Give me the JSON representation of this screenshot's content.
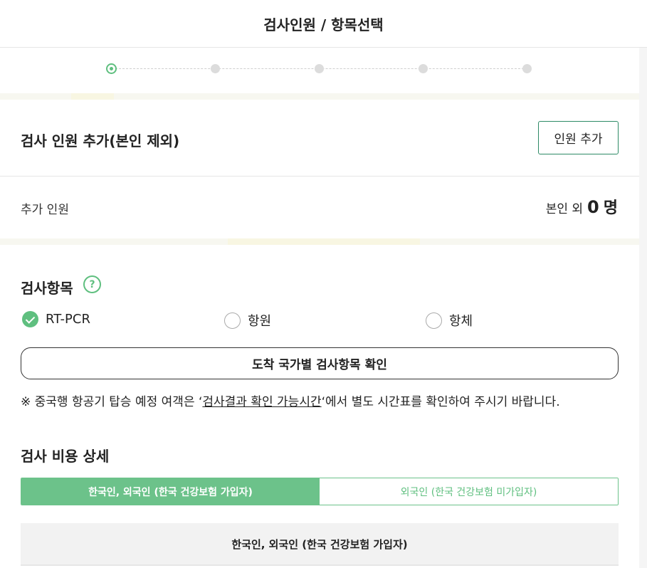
{
  "header": {
    "title": "검사인원 / 항목선택"
  },
  "steps": {
    "count": 5,
    "current": 1
  },
  "add_people": {
    "title": "검사 인원 추가(본인 제외)",
    "add_button": "인원 추가",
    "added_label": "추가 인원",
    "count_prefix": "본인 외",
    "count_value": "0",
    "count_unit": "명"
  },
  "test_items": {
    "title": "검사항목",
    "help_icon": "question-circle-icon",
    "options": [
      {
        "label": "RT-PCR",
        "checked": true
      },
      {
        "label": "항원",
        "checked": false
      },
      {
        "label": "항체",
        "checked": false
      }
    ],
    "country_button": "도착 국가별 검사항목 확인",
    "notice_prefix": "※ 중국행 항공기 탑승 예정 여객은 ‘",
    "notice_link": "검사결과 확인 가능시간",
    "notice_suffix": "‘에서 별도 시간표를 확인하여 주시기 바랍니다."
  },
  "cost": {
    "title": "검사 비용 상세",
    "tabs": [
      {
        "label": "한국인, 외국인 (한국 건강보험 가입자)",
        "active": true
      },
      {
        "label": "외국인 (한국 건강보험 미가입자)",
        "active": false
      }
    ],
    "table_header": "한국인, 외국인 (한국 건강보험 가입자)"
  },
  "colors": {
    "accent": "#5fbf7f",
    "tab_active": "#6cc28a",
    "button_border": "#2d8a66"
  }
}
